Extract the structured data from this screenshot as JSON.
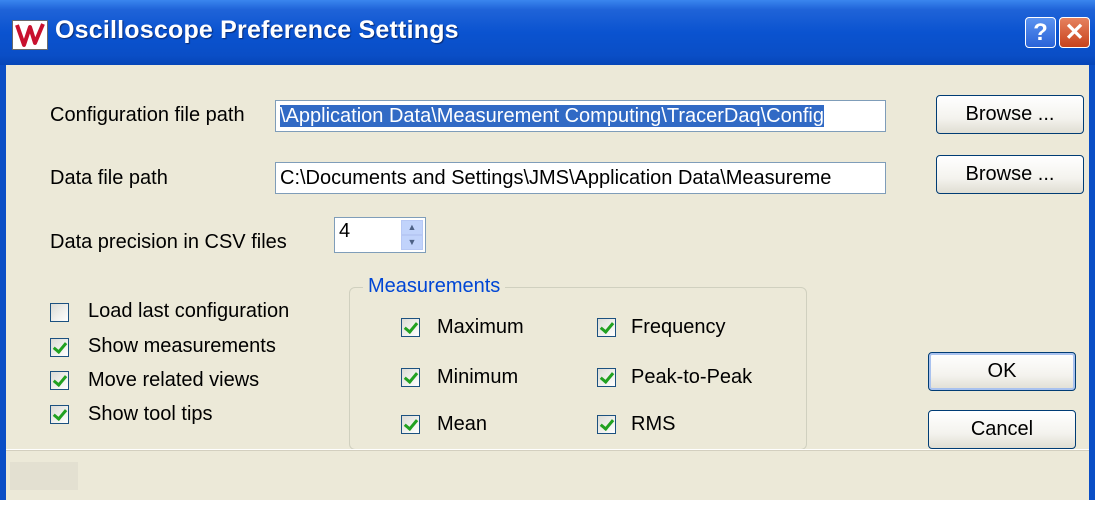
{
  "window": {
    "title": "Oscilloscope Preference Settings",
    "help_button": "?",
    "close_button": "✕"
  },
  "config_path": {
    "label": "Configuration file path",
    "value": "\\Application Data\\Measurement Computing\\TracerDaq\\Config",
    "browse_label": "Browse ..."
  },
  "data_path": {
    "label": "Data file path",
    "value": "C:\\Documents and Settings\\JMS\\Application Data\\Measureme",
    "browse_label": "Browse ..."
  },
  "precision": {
    "label": "Data precision in CSV files",
    "value": "4"
  },
  "options": [
    {
      "label": "Load last configuration",
      "checked": false
    },
    {
      "label": "Show measurements",
      "checked": true
    },
    {
      "label": "Move related views",
      "checked": true
    },
    {
      "label": "Show tool tips",
      "checked": true
    }
  ],
  "measurements": {
    "title": "Measurements",
    "items": [
      {
        "label": "Maximum",
        "checked": true
      },
      {
        "label": "Frequency",
        "checked": true
      },
      {
        "label": "Minimum",
        "checked": true
      },
      {
        "label": "Peak-to-Peak",
        "checked": true
      },
      {
        "label": "Mean",
        "checked": true
      },
      {
        "label": "RMS",
        "checked": true
      }
    ]
  },
  "buttons": {
    "ok_label": "OK",
    "cancel_label": "Cancel"
  },
  "colors": {
    "titlebar": "#0a4ec6",
    "dialog_bg": "#ece9d8",
    "selection": "#316ac5",
    "group_title": "#0046d5",
    "checkmark": "#21a121"
  }
}
